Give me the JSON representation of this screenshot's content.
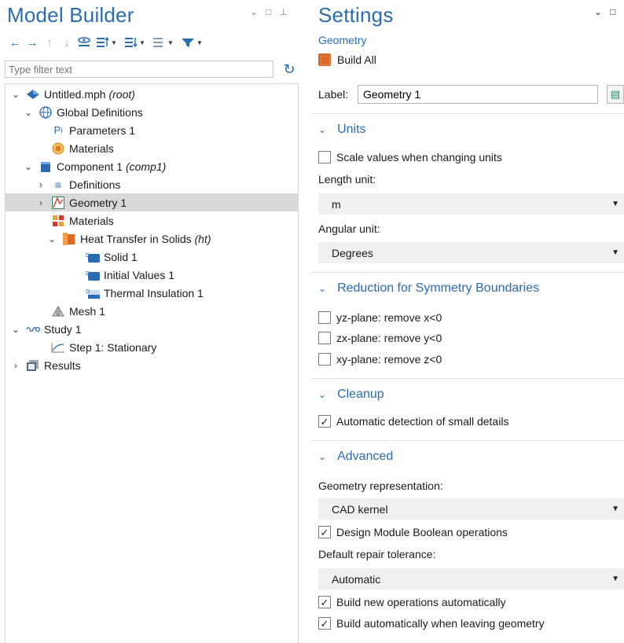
{
  "model_builder": {
    "title": "Model Builder",
    "filter_placeholder": "Type filter text",
    "tree": [
      {
        "label": "Untitled.mph",
        "suffix": "(root)"
      },
      {
        "label": "Global Definitions",
        "suffix": ""
      },
      {
        "label": "Parameters 1",
        "suffix": ""
      },
      {
        "label": "Materials",
        "suffix": ""
      },
      {
        "label": "Component 1",
        "suffix": "(comp1)"
      },
      {
        "label": "Definitions",
        "suffix": ""
      },
      {
        "label": "Geometry 1",
        "suffix": ""
      },
      {
        "label": "Materials",
        "suffix": ""
      },
      {
        "label": "Heat Transfer in Solids",
        "suffix": "(ht)"
      },
      {
        "label": "Solid 1",
        "suffix": ""
      },
      {
        "label": "Initial Values 1",
        "suffix": ""
      },
      {
        "label": "Thermal Insulation 1",
        "suffix": ""
      },
      {
        "label": "Mesh 1",
        "suffix": ""
      },
      {
        "label": "Study 1",
        "suffix": ""
      },
      {
        "label": "Step 1: Stationary",
        "suffix": ""
      },
      {
        "label": "Results",
        "suffix": ""
      }
    ],
    "selected_item": "Geometry 1",
    "icons": {
      "root": "comsol-diamond-icon",
      "global": "globe-icon",
      "params": "parameters-icon",
      "materials": "materials-icon",
      "component": "component-cube-icon",
      "definitions": "definitions-icon",
      "geometry": "geometry-icon",
      "heat": "heat-transfer-icon",
      "domain": "domain-node-icon",
      "mesh": "mesh-icon",
      "study": "study-icon",
      "step": "step-icon",
      "results": "results-icon"
    }
  },
  "settings": {
    "title": "Settings",
    "subtitle": "Geometry",
    "build_all": "Build All",
    "label_caption": "Label:",
    "label_value": "Geometry 1",
    "sections": {
      "units": {
        "title": "Units",
        "scale_values": {
          "label": "Scale values when changing units",
          "checked": false
        },
        "length_unit_label": "Length unit:",
        "length_unit": "m",
        "angular_unit_label": "Angular unit:",
        "angular_unit": "Degrees"
      },
      "symmetry": {
        "title": "Reduction for Symmetry Boundaries",
        "yz": {
          "label": "yz-plane: remove x<0",
          "checked": false
        },
        "zx": {
          "label": "zx-plane: remove y<0",
          "checked": false
        },
        "xy": {
          "label": "xy-plane: remove z<0",
          "checked": false
        }
      },
      "cleanup": {
        "title": "Cleanup",
        "auto_detect": {
          "label": "Automatic detection of small details",
          "checked": true
        }
      },
      "advanced": {
        "title": "Advanced",
        "geom_rep_label": "Geometry representation:",
        "geom_rep": "CAD kernel",
        "design_module": {
          "label": "Design Module Boolean operations",
          "checked": true
        },
        "repair_tol_label": "Default repair tolerance:",
        "repair_tol": "Automatic",
        "build_new": {
          "label": "Build new operations automatically",
          "checked": true
        },
        "build_leaving": {
          "label": "Build automatically when leaving geometry",
          "checked": true
        }
      }
    }
  },
  "colors": {
    "accent": "#2b6cb0",
    "selection": "#d9d9d9",
    "dropdown_bg": "#f0f0f0"
  }
}
